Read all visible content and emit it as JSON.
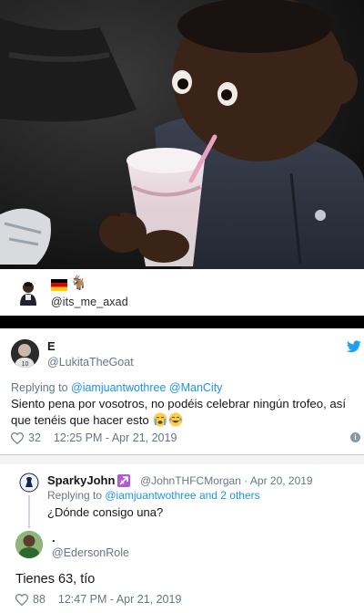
{
  "top_profile": {
    "handle": "@its_me_axad",
    "goat_emoji": "🐐"
  },
  "tweet1": {
    "display_name": "E",
    "handle": "@LukitaTheGoat",
    "replying_prefix": "Replying to ",
    "replying_to": "@iamjuantwothree @ManCity",
    "text": "Siento pena por vosotros, no podéis celebrar ningún trofeo, así que tenéis que hacer esto",
    "likes": "32",
    "timestamp": "12:25 PM - Apr 21, 2019",
    "info_icon": "i"
  },
  "tweet2_parent": {
    "display_name": "SparkyJohn",
    "handle_time": "@JohnTHFCMorgan · Apr 20, 2019",
    "replying_prefix": "Replying to ",
    "replying_to": "@iamjuantwothree and 2 others",
    "text": "¿Dónde consigo una?"
  },
  "tweet2_reply": {
    "display_name": ".",
    "handle": "@EdersonRole",
    "text": "Tienes 63, tío",
    "likes": "88",
    "timestamp": "12:47 PM - Apr 21, 2019"
  },
  "colors": {
    "twitter_blue": "#1da1f2",
    "link_blue": "#1b95e0",
    "muted": "#657786"
  }
}
